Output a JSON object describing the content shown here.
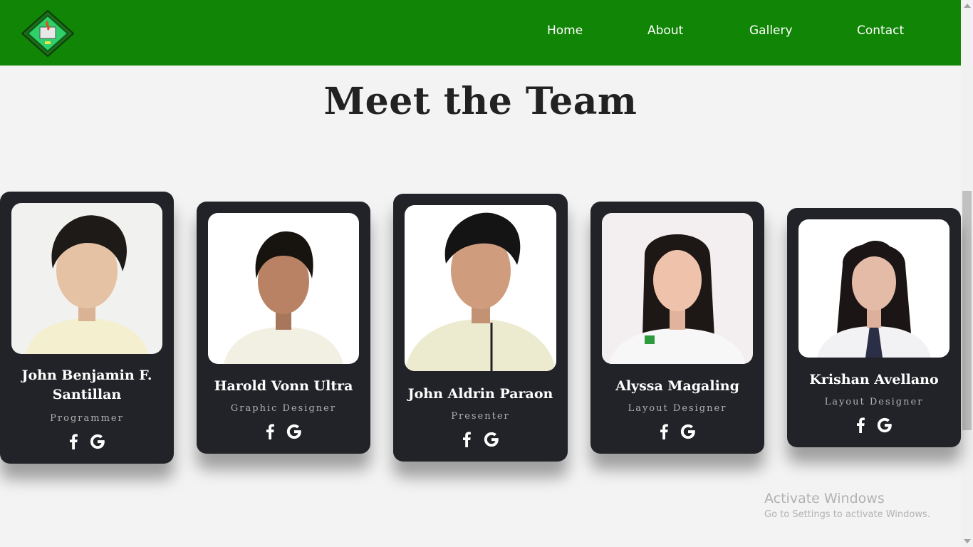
{
  "nav": {
    "links": [
      "Home",
      "About",
      "Gallery",
      "Contact"
    ]
  },
  "section": {
    "title": "Meet the Team"
  },
  "team": [
    {
      "name": "John Benjamin F. Santillan",
      "role": "Programmer"
    },
    {
      "name": "Harold Vonn Ultra",
      "role": "Graphic Designer"
    },
    {
      "name": "John Aldrin Paraon",
      "role": "Presenter"
    },
    {
      "name": "Alyssa Magaling",
      "role": "Layout Designer"
    },
    {
      "name": "Krishan Avellano",
      "role": "Layout Designer"
    }
  ],
  "social_icons": [
    "facebook-icon",
    "google-icon"
  ],
  "watermark": {
    "title": "Activate Windows",
    "subtitle": "Go to Settings to activate Windows."
  },
  "colors": {
    "nav_bg": "#118506",
    "card_bg": "#222328",
    "page_bg": "#f3f3f3"
  }
}
